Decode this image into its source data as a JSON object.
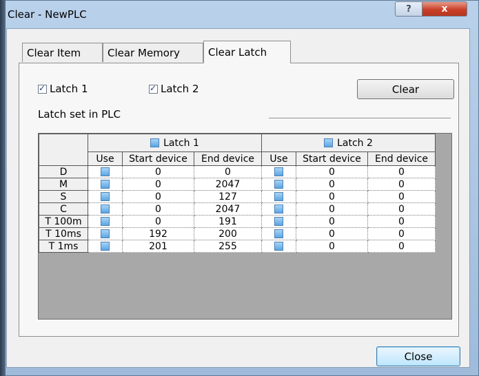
{
  "window": {
    "title": "Clear - NewPLC",
    "help_label": "?",
    "close_label": "x"
  },
  "tabs": [
    {
      "label": "Clear Item",
      "active": false
    },
    {
      "label": "Clear Memory",
      "active": false
    },
    {
      "label": "Clear Latch",
      "active": true
    }
  ],
  "latch_checks": [
    {
      "label": "Latch 1",
      "checked": true
    },
    {
      "label": "Latch 2",
      "checked": true
    }
  ],
  "clear_button": "Clear",
  "latch_set_label": "Latch set in  PLC",
  "grid": {
    "groups": [
      "Latch 1",
      "Latch 2"
    ],
    "columns": [
      "Use",
      "Start device",
      "End device",
      "Use",
      "Start device",
      "End device"
    ],
    "rows": [
      {
        "device": "D",
        "l1_start": "0",
        "l1_end": "0",
        "l2_start": "0",
        "l2_end": "0"
      },
      {
        "device": "M",
        "l1_start": "0",
        "l1_end": "2047",
        "l2_start": "0",
        "l2_end": "0"
      },
      {
        "device": "S",
        "l1_start": "0",
        "l1_end": "127",
        "l2_start": "0",
        "l2_end": "0"
      },
      {
        "device": "C",
        "l1_start": "0",
        "l1_end": "2047",
        "l2_start": "0",
        "l2_end": "0"
      },
      {
        "device": "T 100m",
        "l1_start": "0",
        "l1_end": "191",
        "l2_start": "0",
        "l2_end": "0"
      },
      {
        "device": "T 10ms",
        "l1_start": "192",
        "l1_end": "200",
        "l2_start": "0",
        "l2_end": "0"
      },
      {
        "device": "T 1ms",
        "l1_start": "201",
        "l1_end": "255",
        "l2_start": "0",
        "l2_end": "0"
      }
    ]
  },
  "close_button": "Close"
}
